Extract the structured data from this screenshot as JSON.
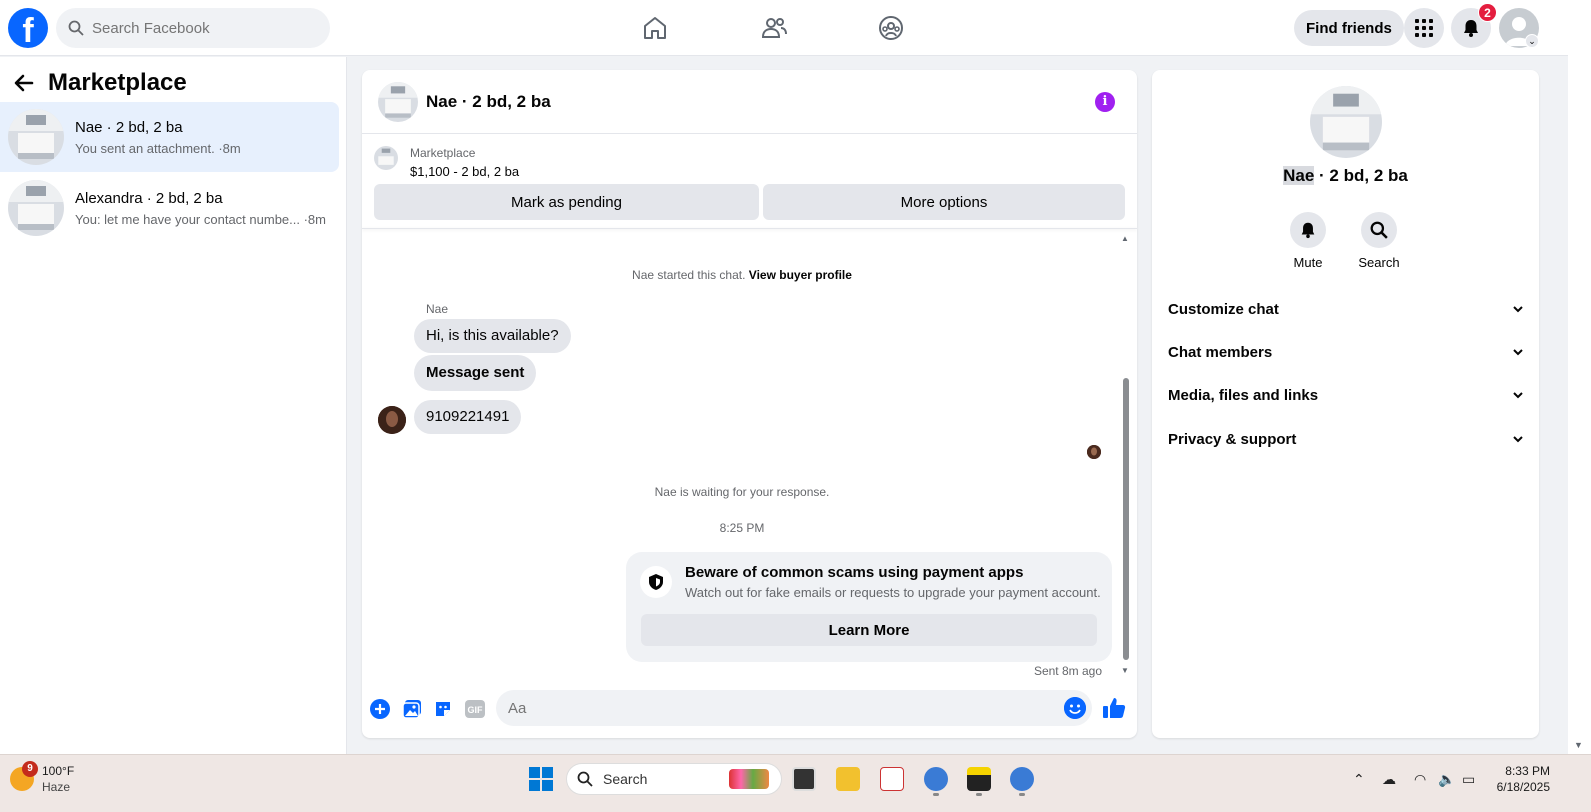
{
  "header": {
    "search_placeholder": "Search Facebook",
    "find_friends_label": "Find friends",
    "notification_count": "2",
    "logo_letter": "f"
  },
  "sidebar": {
    "title": "Marketplace",
    "conversations": [
      {
        "name": "Nae · 2 bd, 2 ba",
        "preview": "You sent an attachment. ·8m",
        "active": true
      },
      {
        "name": "Alexandra · 2 bd, 2 ba",
        "preview": "You: let me have your contact numbe... ·8m",
        "active": false
      }
    ]
  },
  "chat": {
    "title": "Nae · 2 bd, 2 ba",
    "listing_label": "Marketplace",
    "listing_price": "$1,100 - 2 bd, 2 ba",
    "mark_pending_label": "Mark as pending",
    "more_options_label": "More options",
    "started_text": "Nae started this chat.",
    "view_profile_label": "View buyer profile",
    "sender_name": "Nae",
    "messages": [
      {
        "text": "Hi, is this available?",
        "bold": false
      },
      {
        "text": "Message sent",
        "bold": true
      },
      {
        "text": "9109221491",
        "bold": false
      }
    ],
    "waiting_text": "Nae is waiting for your response.",
    "timestamp": "8:25 PM",
    "scam_title": "Beware of common scams using payment apps",
    "scam_subtitle": "Watch out for fake emails or requests to upgrade your payment account.",
    "learn_more_label": "Learn More",
    "sent_time": "Sent 8m ago",
    "composer_placeholder": "Aa",
    "gif_label": "GIF"
  },
  "details": {
    "title_name": "Nae",
    "title_rest": " · 2 bd, 2 ba",
    "mute_label": "Mute",
    "search_label": "Search",
    "sections": [
      "Customize chat",
      "Chat members",
      "Media, files and links",
      "Privacy & support"
    ]
  },
  "taskbar": {
    "weather_badge": "9",
    "temperature": "100°F",
    "condition": "Haze",
    "search_label": "Search",
    "time": "8:33 PM",
    "date": "6/18/2025"
  },
  "colors": {
    "brand_blue": "#0866ff",
    "active_conv": "#e7f0fd",
    "info_purple": "#a020f0",
    "badge_red": "#e41e3f"
  }
}
